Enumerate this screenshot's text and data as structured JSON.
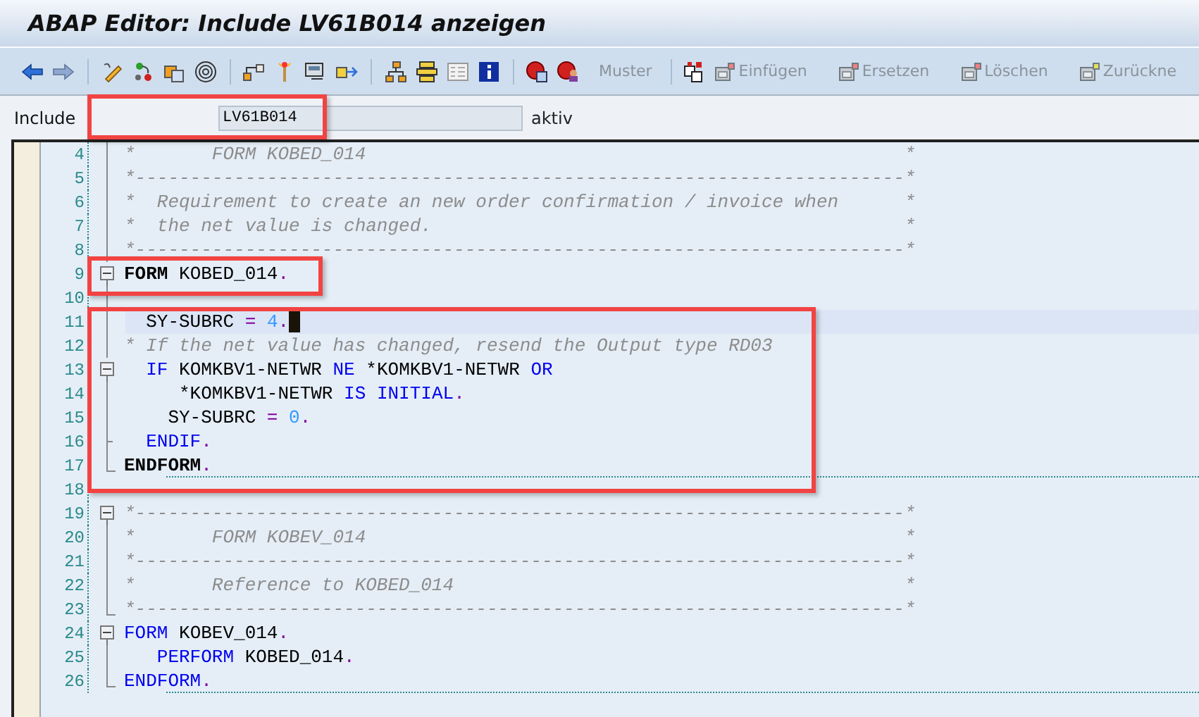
{
  "window": {
    "title": "ABAP Editor: Include LV61B014 anzeigen"
  },
  "toolbar": {
    "buttons": [
      {
        "label": "Muster",
        "disabled": true
      },
      {
        "label": "Einfügen",
        "disabled": true
      },
      {
        "label": "Ersetzen",
        "disabled": true
      },
      {
        "label": "Löschen",
        "disabled": true
      },
      {
        "label": "Zurückne",
        "disabled": true
      }
    ]
  },
  "include": {
    "label": "Include",
    "value": "LV61B014",
    "status": "aktiv"
  },
  "editor": {
    "lines": [
      {
        "number": "4",
        "fold": {
          "kind": "line"
        },
        "tokens": [
          {
            "kind": "comment",
            "t": "*       FORM KOBED_014                                                 *"
          }
        ]
      },
      {
        "number": "5",
        "fold": {
          "kind": "line"
        },
        "tokens": [
          {
            "kind": "comment",
            "t": "*----------------------------------------------------------------------*"
          }
        ]
      },
      {
        "number": "6",
        "fold": {
          "kind": "line"
        },
        "tokens": [
          {
            "kind": "comment",
            "t": "*  Requirement to create an new order confirmation / invoice when      *"
          }
        ]
      },
      {
        "number": "7",
        "fold": {
          "kind": "line"
        },
        "tokens": [
          {
            "kind": "comment",
            "t": "*  the net value is changed.                                           *"
          }
        ]
      },
      {
        "number": "8",
        "fold": {
          "kind": "line"
        },
        "tokens": [
          {
            "kind": "comment",
            "t": "*----------------------------------------------------------------------*"
          }
        ]
      },
      {
        "number": "9",
        "fold": {
          "kind": "start"
        },
        "tokens": [
          {
            "kind": "bold",
            "t": "FORM"
          },
          {
            "kind": "plain",
            "t": " KOBED_014"
          },
          {
            "kind": "punct",
            "t": "."
          }
        ]
      },
      {
        "number": "10",
        "fold": {
          "kind": "line"
        }
      },
      {
        "number": "11",
        "fold": {
          "kind": "line"
        },
        "current": true,
        "tokens": [
          {
            "kind": "plain",
            "t": "  SY-SUBRC "
          },
          {
            "kind": "op",
            "t": "="
          },
          {
            "kind": "num",
            "t": " 4"
          },
          {
            "kind": "punct",
            "t": "."
          }
        ]
      },
      {
        "number": "12",
        "fold": {
          "kind": "line"
        },
        "tokens": [
          {
            "kind": "comment",
            "t": "* If the net value has changed, resend the Output type RD03"
          }
        ]
      },
      {
        "number": "13",
        "fold": {
          "kind": "start"
        },
        "tokens": [
          {
            "kind": "kw",
            "t": "  IF"
          },
          {
            "kind": "plain",
            "t": " KOMKBV1-NETWR "
          },
          {
            "kind": "kw",
            "t": "NE"
          },
          {
            "kind": "plain",
            "t": " *KOMKBV1-NETWR "
          },
          {
            "kind": "kw",
            "t": "OR"
          }
        ]
      },
      {
        "number": "14",
        "fold": {
          "kind": "line"
        },
        "tokens": [
          {
            "kind": "plain",
            "t": "     *KOMKBV1-NETWR "
          },
          {
            "kind": "kw",
            "t": "IS"
          },
          {
            "kind": "kw",
            "t": " INITIAL"
          },
          {
            "kind": "punct",
            "t": "."
          }
        ]
      },
      {
        "number": "15",
        "fold": {
          "kind": "line"
        },
        "tokens": [
          {
            "kind": "plain",
            "t": "    SY-SUBRC "
          },
          {
            "kind": "op",
            "t": "="
          },
          {
            "kind": "num",
            "t": " 0"
          },
          {
            "kind": "punct",
            "t": "."
          }
        ]
      },
      {
        "number": "16",
        "fold": {
          "kind": "tick"
        },
        "tokens": [
          {
            "kind": "kw",
            "t": "  ENDIF"
          },
          {
            "kind": "punct",
            "t": "."
          }
        ]
      },
      {
        "number": "17",
        "fold": {
          "kind": "end"
        },
        "separator": true,
        "tokens": [
          {
            "kind": "bold",
            "t": "ENDFORM"
          },
          {
            "kind": "punct",
            "t": "."
          }
        ]
      },
      {
        "number": "18",
        "fold": {
          "kind": "none"
        }
      },
      {
        "number": "19",
        "fold": {
          "kind": "start"
        },
        "tokens": [
          {
            "kind": "comment",
            "t": "*----------------------------------------------------------------------*"
          }
        ]
      },
      {
        "number": "20",
        "fold": {
          "kind": "line"
        },
        "tokens": [
          {
            "kind": "comment",
            "t": "*       FORM KOBEV_014                                                 *"
          }
        ]
      },
      {
        "number": "21",
        "fold": {
          "kind": "line"
        },
        "tokens": [
          {
            "kind": "comment",
            "t": "*----------------------------------------------------------------------*"
          }
        ]
      },
      {
        "number": "22",
        "fold": {
          "kind": "line"
        },
        "tokens": [
          {
            "kind": "comment",
            "t": "*       Reference to KOBED_014                                         *"
          }
        ]
      },
      {
        "number": "23",
        "fold": {
          "kind": "end"
        },
        "tokens": [
          {
            "kind": "comment",
            "t": "*----------------------------------------------------------------------*"
          }
        ]
      },
      {
        "number": "24",
        "fold": {
          "kind": "start"
        },
        "tokens": [
          {
            "kind": "kw",
            "t": "FORM"
          },
          {
            "kind": "plain",
            "t": " KOBEV_014"
          },
          {
            "kind": "punct",
            "t": "."
          }
        ]
      },
      {
        "number": "25",
        "fold": {
          "kind": "line"
        },
        "tokens": [
          {
            "kind": "kw",
            "t": "   PERFORM"
          },
          {
            "kind": "plain",
            "t": " KOBED_014"
          },
          {
            "kind": "punct",
            "t": "."
          }
        ]
      },
      {
        "number": "26",
        "fold": {
          "kind": "end"
        },
        "separator": true,
        "tokens": [
          {
            "kind": "kw",
            "t": "ENDFORM"
          },
          {
            "kind": "punct",
            "t": "."
          }
        ]
      }
    ]
  }
}
